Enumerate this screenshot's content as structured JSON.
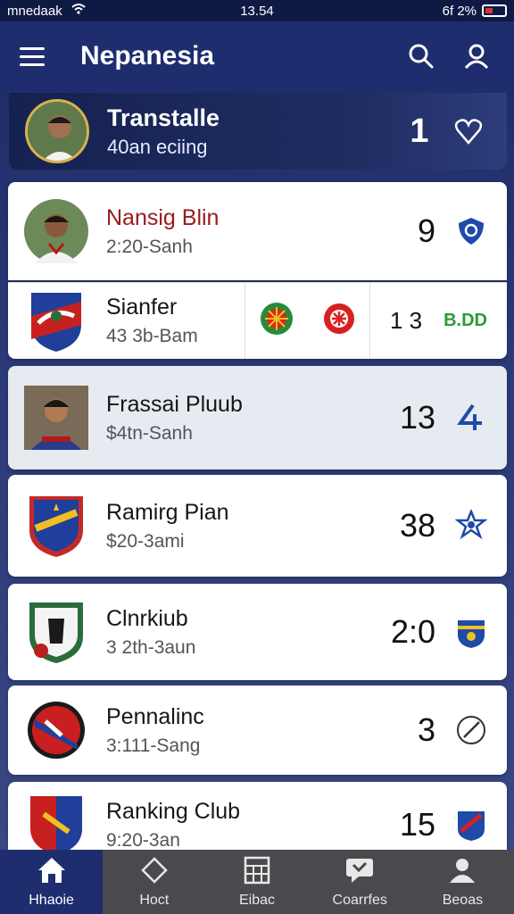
{
  "status_bar": {
    "carrier": "mnedaak",
    "time": "13.54",
    "battery": "6f 2%"
  },
  "app_bar": {
    "title": "Nepanesia",
    "icons": [
      "menu-icon",
      "search-icon",
      "user-icon"
    ]
  },
  "featured": {
    "title": "Transtalle",
    "subtitle": "40an eciing",
    "number": "1",
    "action_icon": "heart-outline-icon"
  },
  "list": [
    {
      "name": "Nansig Blin",
      "time": "2:20-Sanh",
      "value": "9",
      "icon": "shield-badge-icon",
      "accent": "#9a1a1a"
    },
    {
      "name": "Sianfer",
      "time": "43 3b-Bam",
      "value": "1 3",
      "stat": "B.DD",
      "badges": [
        "sun-emblem-icon",
        "star-emblem-icon"
      ]
    },
    {
      "name": "Frassai Pluub",
      "time": "$4tn-Sanh",
      "value": "13",
      "icon": "arrow-icon"
    },
    {
      "name": "Ramirg Pian",
      "time": "$20-3ami",
      "value": "38",
      "icon": "star-badge-icon"
    },
    {
      "name": "Clnrkiub",
      "time": "3 2th-3aun",
      "value": "2:0",
      "icon": "crest-icon"
    },
    {
      "name": "Pennalinc",
      "time": "3:111-Sang",
      "value": "3",
      "icon": "pen-icon"
    },
    {
      "name": "Ranking Club",
      "time": "9:20-3an",
      "value": "15",
      "icon": "badge-icon"
    }
  ],
  "bottom_nav": [
    {
      "label": "Hhaoie",
      "icon": "home-icon",
      "active": true
    },
    {
      "label": "Hoct",
      "icon": "diamond-icon",
      "active": false
    },
    {
      "label": "Eibac",
      "icon": "grid-icon",
      "active": false
    },
    {
      "label": "Coarrfes",
      "icon": "chat-icon",
      "active": false
    },
    {
      "label": "Beoas",
      "icon": "person-icon",
      "active": false
    }
  ],
  "colors": {
    "primary": "#1d2d6e",
    "card": "#ffffff",
    "highlight": "#e6eaf1",
    "nav_bg": "#4a4a4e",
    "accent_green": "#2c9a3a"
  }
}
